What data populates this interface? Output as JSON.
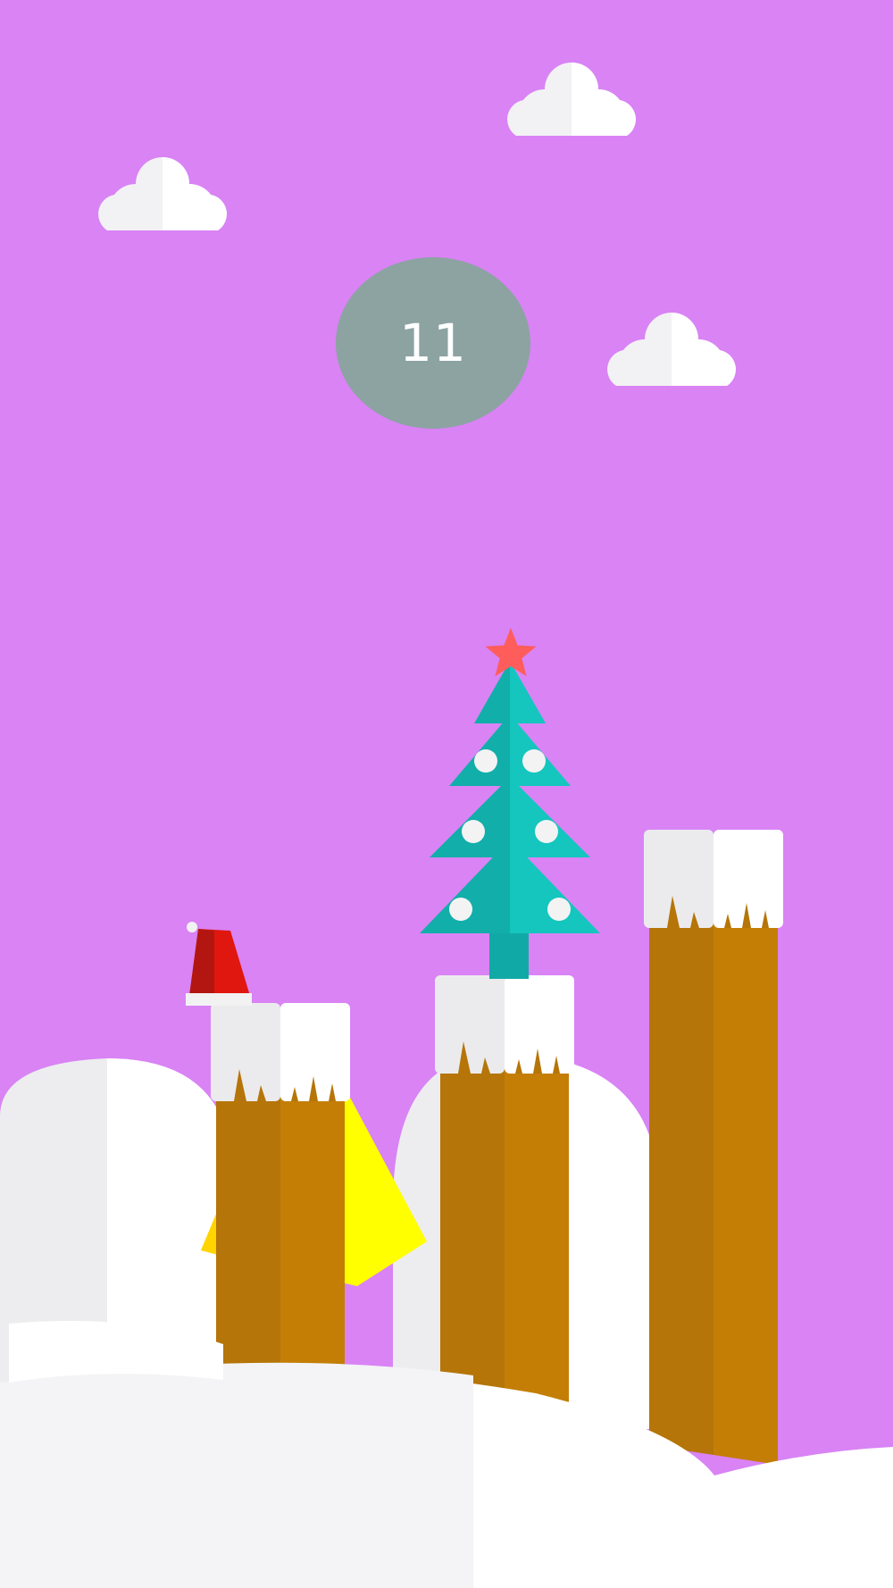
{
  "game": {
    "score": "11"
  },
  "colors": {
    "sky": "#D983F5",
    "cloud_light": "#F2F2F4",
    "cloud_dark": "#FFFFFF",
    "score_badge": "#8CA3A2",
    "snow_shade": "#EDEDEF",
    "snow_white": "#FFFFFF",
    "snow_ground": "#F4F4F6",
    "chimney_dark": "#B57508",
    "chimney_light": "#C47E06",
    "chimney_snow_dark": "#EBEBED",
    "chimney_snow_light": "#FFFFFF",
    "tree_dark": "#12AEAA",
    "tree_light": "#14C6BE",
    "tree_trunk": "#11A9A6",
    "tree_ornament": "#F3F3F3",
    "star": "#FF5C5C",
    "hat_red": "#E0170E",
    "hat_dark": "#B31610",
    "hat_trim": "#F2F2F2",
    "bell_yellow": "#FFFF00",
    "bell_shade": "#FFD400"
  },
  "icons": {
    "clouds": "cloud-icon",
    "tree": "christmas-tree-icon",
    "star": "star-icon",
    "hat": "santa-hat-icon",
    "bell": "bell-icon"
  }
}
